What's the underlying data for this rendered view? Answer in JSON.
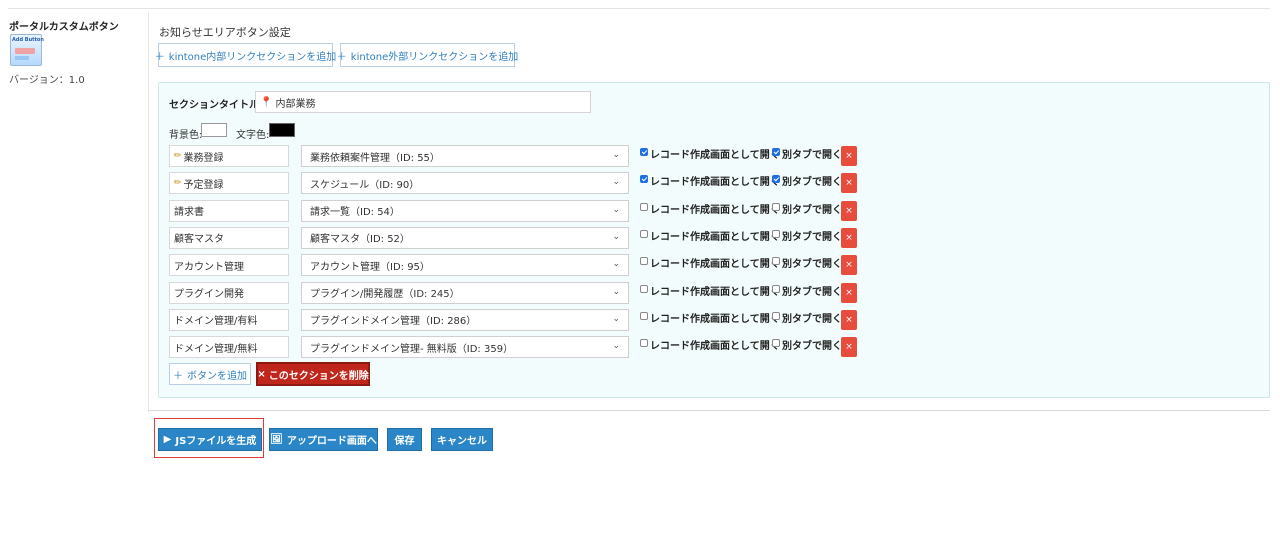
{
  "sidebar": {
    "plugin_name": "ポータルカスタムボタン",
    "icon_text": "Add Button",
    "version": "バージョン：1.0"
  },
  "main": {
    "title": "お知らせエリアボタン設定",
    "add_internal_label": "kintone内部リンクセクションを追加",
    "add_external_label": "kintone外部リンクセクションを追加"
  },
  "section": {
    "title_label": "セクションタイトル:",
    "title_value": "内部業務",
    "bg_label": "背景色:",
    "text_color_label": "文字色:",
    "bg_color": "#ffffff",
    "text_color": "#000000",
    "record_label": "レコード作成画面として開く",
    "newtab_label": "別タブで開く",
    "rows": [
      {
        "name": "業務登録",
        "pencil": true,
        "app": "業務依頼案件管理（ID: 55）",
        "record": true,
        "newtab": true
      },
      {
        "name": "予定登録",
        "pencil": true,
        "app": "スケジュール（ID: 90）",
        "record": true,
        "newtab": true
      },
      {
        "name": "請求書",
        "pencil": false,
        "app": "請求一覧（ID: 54）",
        "record": false,
        "newtab": false
      },
      {
        "name": "顧客マスタ",
        "pencil": false,
        "app": "顧客マスタ（ID: 52）",
        "record": false,
        "newtab": false
      },
      {
        "name": "アカウント管理",
        "pencil": false,
        "app": "アカウント管理（ID: 95）",
        "record": false,
        "newtab": false
      },
      {
        "name": "プラグイン開発",
        "pencil": false,
        "app": "プラグイン/開発履歴（ID: 245）",
        "record": false,
        "newtab": false
      },
      {
        "name": "ドメイン管理/有料",
        "pencil": false,
        "app": "プラグインドメイン管理（ID: 286）",
        "record": false,
        "newtab": false
      },
      {
        "name": "ドメイン管理/無料",
        "pencil": false,
        "app": "プラグインドメイン管理- 無料版（ID: 359）",
        "record": false,
        "newtab": false
      }
    ],
    "add_button_label": "ボタンを追加",
    "delete_section_label": "このセクションを削除"
  },
  "actions": {
    "generate_js": "JSファイルを生成",
    "upload": "アップロード画面へ",
    "save": "保存",
    "cancel": "キャンセル"
  },
  "colors": {
    "primary": "#2a86c6",
    "danger": "#e74c3c",
    "danger_dark": "#c0271c",
    "section_bg": "#f3fcfc"
  }
}
